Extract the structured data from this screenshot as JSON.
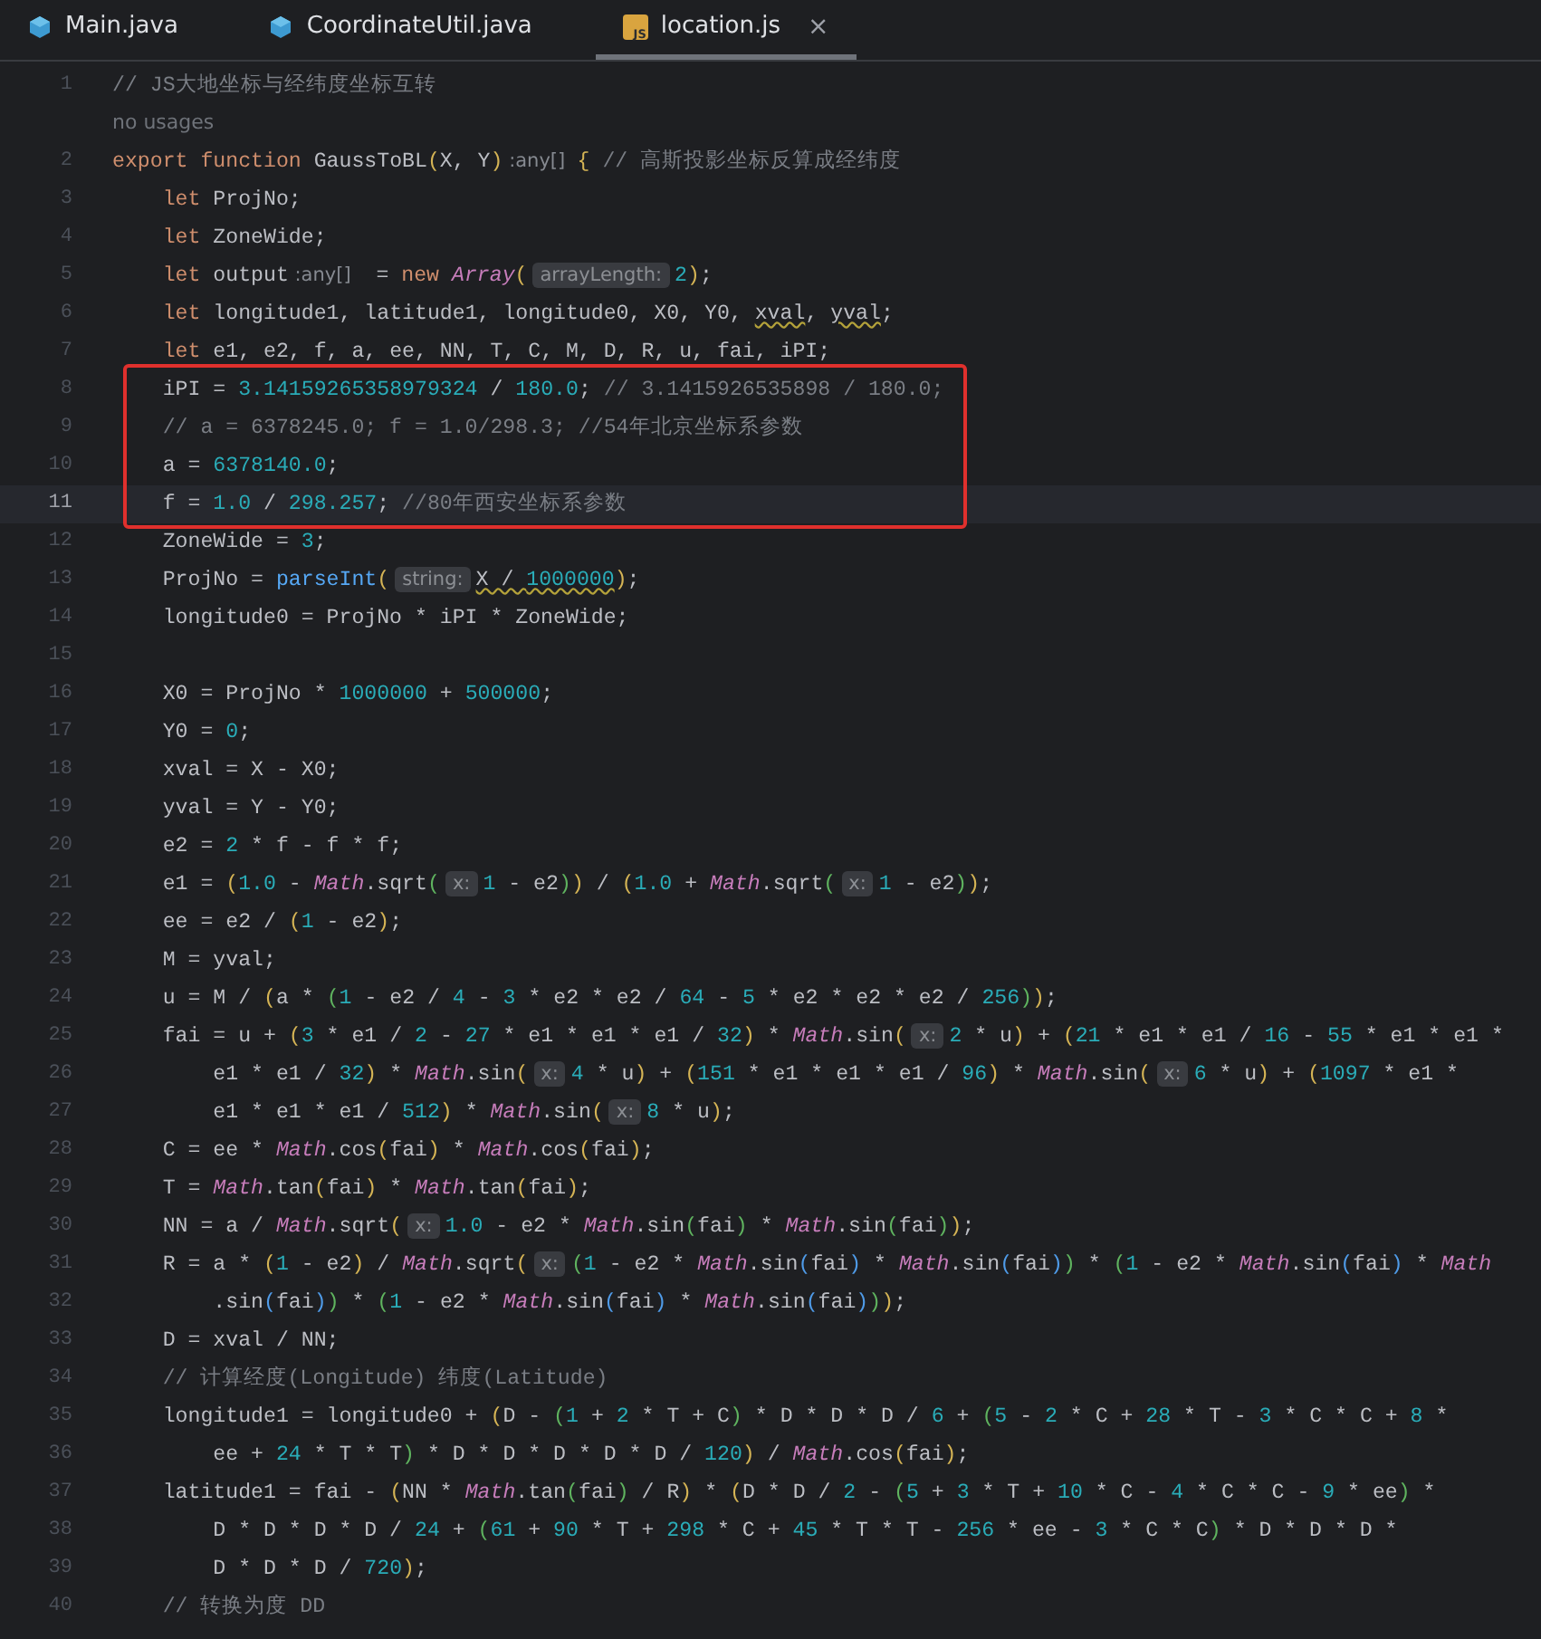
{
  "tabs": [
    {
      "label": "Main.java",
      "selected": false,
      "closable": false
    },
    {
      "label": "CoordinateUtil.java",
      "selected": false,
      "closable": false
    },
    {
      "label": "location.js",
      "icon_text": "JS",
      "selected": true,
      "closable": true,
      "close": "×"
    }
  ],
  "code": [
    {
      "kind": "line",
      "number": "1",
      "current": false,
      "segments": [
        {
          "kind": "cmt",
          "text": "// JS大地坐标与经纬度坐标互转"
        }
      ]
    },
    {
      "kind": "usages",
      "text": "no usages"
    },
    {
      "kind": "line",
      "number": "2",
      "current": false,
      "segments": [
        {
          "kind": "kw",
          "text": "export function "
        },
        {
          "kind": "t",
          "text": "GaussToBL"
        },
        {
          "kind": "p1",
          "text": "("
        },
        {
          "kind": "t",
          "text": "X, Y"
        },
        {
          "kind": "p1",
          "text": ")"
        },
        {
          "kind": "type",
          "text": " :any[]  "
        },
        {
          "kind": "p1",
          "text": "{"
        },
        {
          "kind": "cmt",
          "text": " // 高斯投影坐标反算成经纬度"
        }
      ]
    },
    {
      "kind": "line",
      "number": "3",
      "current": false,
      "segments": [
        {
          "kind": "kw",
          "text": "    let "
        },
        {
          "kind": "t",
          "text": "ProjNo;"
        }
      ]
    },
    {
      "kind": "line",
      "number": "4",
      "current": false,
      "segments": [
        {
          "kind": "kw",
          "text": "    let "
        },
        {
          "kind": "t",
          "text": "ZoneWide;"
        }
      ]
    },
    {
      "kind": "line",
      "number": "5",
      "current": false,
      "segments": [
        {
          "kind": "kw",
          "text": "    let "
        },
        {
          "kind": "t",
          "text": "output"
        },
        {
          "kind": "type",
          "text": " :any[]"
        },
        {
          "kind": "t",
          "text": "  = "
        },
        {
          "kind": "kw",
          "text": "new "
        },
        {
          "kind": "cls",
          "text": "Array"
        },
        {
          "kind": "p1",
          "text": "("
        },
        {
          "kind": "hint",
          "text": "arrayLength:"
        },
        {
          "kind": "num",
          "text": "2"
        },
        {
          "kind": "p1",
          "text": ")"
        },
        {
          "kind": "t",
          "text": ";"
        }
      ]
    },
    {
      "kind": "line",
      "number": "6",
      "current": false,
      "segments": [
        {
          "kind": "kw",
          "text": "    let "
        },
        {
          "kind": "t",
          "text": "longitude1, latitude1, longitude0, X0, Y0, "
        },
        {
          "kind": "warn",
          "text": "xval"
        },
        {
          "kind": "t",
          "text": ", "
        },
        {
          "kind": "warn",
          "text": "yval"
        },
        {
          "kind": "t",
          "text": ";"
        }
      ]
    },
    {
      "kind": "line",
      "number": "7",
      "current": false,
      "segments": [
        {
          "kind": "kw",
          "text": "    let "
        },
        {
          "kind": "t",
          "text": "e1, e2, f, a, ee, NN, T, C, M, D, R, u, fai, iPI;"
        }
      ]
    },
    {
      "kind": "boxed",
      "rows": [
        {
          "kind": "line",
          "number": "8",
          "current": false,
          "segments": [
            {
              "kind": "t",
              "text": "    iPI = "
            },
            {
              "kind": "num",
              "text": "3.14159265358979324"
            },
            {
              "kind": "t",
              "text": " / "
            },
            {
              "kind": "num",
              "text": "180.0"
            },
            {
              "kind": "t",
              "text": "; "
            },
            {
              "kind": "cmt",
              "text": "// 3.1415926535898 / 180.0;"
            }
          ]
        },
        {
          "kind": "line",
          "number": "9",
          "current": false,
          "segments": [
            {
              "kind": "cmt",
              "text": "    // a = 6378245.0; f = 1.0/298.3; //54年北京坐标系参数"
            }
          ]
        },
        {
          "kind": "line",
          "number": "10",
          "current": false,
          "segments": [
            {
              "kind": "t",
              "text": "    a = "
            },
            {
              "kind": "num",
              "text": "6378140.0"
            },
            {
              "kind": "t",
              "text": ";"
            }
          ]
        },
        {
          "kind": "line",
          "number": "11",
          "current": true,
          "segments": [
            {
              "kind": "t",
              "text": "    f = "
            },
            {
              "kind": "num",
              "text": "1.0"
            },
            {
              "kind": "t",
              "text": " / "
            },
            {
              "kind": "num",
              "text": "298.257"
            },
            {
              "kind": "t",
              "text": "; "
            },
            {
              "kind": "cmt",
              "text": "//80年西安坐标系参数"
            }
          ]
        }
      ]
    },
    {
      "kind": "line",
      "number": "12",
      "current": false,
      "segments": [
        {
          "kind": "t",
          "text": "    ZoneWide = "
        },
        {
          "kind": "num",
          "text": "3"
        },
        {
          "kind": "t",
          "text": ";"
        }
      ]
    },
    {
      "kind": "line",
      "number": "13",
      "current": false,
      "segments": [
        {
          "kind": "t",
          "text": "    ProjNo = "
        },
        {
          "kind": "fn",
          "text": "parseInt"
        },
        {
          "kind": "p1",
          "text": "("
        },
        {
          "kind": "hint",
          "text": "string:"
        },
        {
          "kind": "warn",
          "text": "X / "
        },
        {
          "kind": "warn_num",
          "text": "1000000"
        },
        {
          "kind": "p1",
          "text": ")"
        },
        {
          "kind": "t",
          "text": ";"
        }
      ]
    },
    {
      "kind": "line",
      "number": "14",
      "current": false,
      "segments": [
        {
          "kind": "t",
          "text": "    longitude0 = ProjNo * iPI * ZoneWide;"
        }
      ]
    },
    {
      "kind": "line",
      "number": "15",
      "current": false
    },
    {
      "kind": "line",
      "number": "16",
      "current": false,
      "segments": [
        {
          "kind": "t",
          "text": "    X0 = ProjNo * "
        },
        {
          "kind": "num",
          "text": "1000000"
        },
        {
          "kind": "t",
          "text": " + "
        },
        {
          "kind": "num",
          "text": "500000"
        },
        {
          "kind": "t",
          "text": ";"
        }
      ]
    },
    {
      "kind": "line",
      "number": "17",
      "current": false,
      "segments": [
        {
          "kind": "t",
          "text": "    Y0 = "
        },
        {
          "kind": "num",
          "text": "0"
        },
        {
          "kind": "t",
          "text": ";"
        }
      ]
    },
    {
      "kind": "line",
      "number": "18",
      "current": false,
      "segments": [
        {
          "kind": "t",
          "text": "    xval = X - X0;"
        }
      ]
    },
    {
      "kind": "line",
      "number": "19",
      "current": false,
      "segments": [
        {
          "kind": "t",
          "text": "    yval = Y - Y0;"
        }
      ]
    },
    {
      "kind": "line",
      "number": "20",
      "current": false,
      "segments": [
        {
          "kind": "t",
          "text": "    e2 = "
        },
        {
          "kind": "num",
          "text": "2"
        },
        {
          "kind": "t",
          "text": " * f - f * f;"
        }
      ]
    },
    {
      "kind": "line",
      "number": "21",
      "current": false,
      "segments": [
        {
          "kind": "t",
          "text": "    e1 = "
        },
        {
          "kind": "p1",
          "text": "("
        },
        {
          "kind": "num",
          "text": "1.0"
        },
        {
          "kind": "t",
          "text": " - "
        },
        {
          "kind": "cls",
          "text": "Math"
        },
        {
          "kind": "t",
          "text": ".sqrt"
        },
        {
          "kind": "p2",
          "text": "("
        },
        {
          "kind": "hint",
          "text": "x:"
        },
        {
          "kind": "num",
          "text": "1"
        },
        {
          "kind": "t",
          "text": " - e2"
        },
        {
          "kind": "p2",
          "text": ")"
        },
        {
          "kind": "p1",
          "text": ")"
        },
        {
          "kind": "t",
          "text": " / "
        },
        {
          "kind": "p1",
          "text": "("
        },
        {
          "kind": "num",
          "text": "1.0"
        },
        {
          "kind": "t",
          "text": " + "
        },
        {
          "kind": "cls",
          "text": "Math"
        },
        {
          "kind": "t",
          "text": ".sqrt"
        },
        {
          "kind": "p2",
          "text": "("
        },
        {
          "kind": "hint",
          "text": "x:"
        },
        {
          "kind": "num",
          "text": "1"
        },
        {
          "kind": "t",
          "text": " - e2"
        },
        {
          "kind": "p2",
          "text": ")"
        },
        {
          "kind": "p1",
          "text": ")"
        },
        {
          "kind": "t",
          "text": ";"
        }
      ]
    },
    {
      "kind": "line",
      "number": "22",
      "current": false,
      "segments": [
        {
          "kind": "t",
          "text": "    ee = e2 / "
        },
        {
          "kind": "p1",
          "text": "("
        },
        {
          "kind": "num",
          "text": "1"
        },
        {
          "kind": "t",
          "text": " - e2"
        },
        {
          "kind": "p1",
          "text": ")"
        },
        {
          "kind": "t",
          "text": ";"
        }
      ]
    },
    {
      "kind": "line",
      "number": "23",
      "current": false,
      "segments": [
        {
          "kind": "t",
          "text": "    M = yval;"
        }
      ]
    },
    {
      "kind": "line",
      "number": "24",
      "current": false,
      "segments": [
        {
          "kind": "t",
          "text": "    u = M / "
        },
        {
          "kind": "p1",
          "text": "("
        },
        {
          "kind": "t",
          "text": "a * "
        },
        {
          "kind": "p2",
          "text": "("
        },
        {
          "kind": "num",
          "text": "1"
        },
        {
          "kind": "t",
          "text": " - e2 / "
        },
        {
          "kind": "num",
          "text": "4"
        },
        {
          "kind": "t",
          "text": " - "
        },
        {
          "kind": "num",
          "text": "3"
        },
        {
          "kind": "t",
          "text": " * e2 * e2 / "
        },
        {
          "kind": "num",
          "text": "64"
        },
        {
          "kind": "t",
          "text": " - "
        },
        {
          "kind": "num",
          "text": "5"
        },
        {
          "kind": "t",
          "text": " * e2 * e2 * e2 / "
        },
        {
          "kind": "num",
          "text": "256"
        },
        {
          "kind": "p2",
          "text": ")"
        },
        {
          "kind": "p1",
          "text": ")"
        },
        {
          "kind": "t",
          "text": ";"
        }
      ]
    },
    {
      "kind": "line",
      "number": "25",
      "current": false,
      "segments": [
        {
          "kind": "t",
          "text": "    fai = u + "
        },
        {
          "kind": "p1",
          "text": "("
        },
        {
          "kind": "num",
          "text": "3"
        },
        {
          "kind": "t",
          "text": " * e1 / "
        },
        {
          "kind": "num",
          "text": "2"
        },
        {
          "kind": "t",
          "text": " - "
        },
        {
          "kind": "num",
          "text": "27"
        },
        {
          "kind": "t",
          "text": " * e1 * e1 * e1 / "
        },
        {
          "kind": "num",
          "text": "32"
        },
        {
          "kind": "p1",
          "text": ")"
        },
        {
          "kind": "t",
          "text": " * "
        },
        {
          "kind": "cls",
          "text": "Math"
        },
        {
          "kind": "t",
          "text": ".sin"
        },
        {
          "kind": "p1",
          "text": "("
        },
        {
          "kind": "hint",
          "text": "x:"
        },
        {
          "kind": "num",
          "text": "2"
        },
        {
          "kind": "t",
          "text": " * u"
        },
        {
          "kind": "p1",
          "text": ")"
        },
        {
          "kind": "t",
          "text": " + "
        },
        {
          "kind": "p1",
          "text": "("
        },
        {
          "kind": "num",
          "text": "21"
        },
        {
          "kind": "t",
          "text": " * e1 * e1 / "
        },
        {
          "kind": "num",
          "text": "16"
        },
        {
          "kind": "t",
          "text": " - "
        },
        {
          "kind": "num",
          "text": "55"
        },
        {
          "kind": "t",
          "text": " * e1 * e1 *"
        }
      ]
    },
    {
      "kind": "line",
      "number": "26",
      "current": false,
      "segments": [
        {
          "kind": "t",
          "text": "        e1 * e1 / "
        },
        {
          "kind": "num",
          "text": "32"
        },
        {
          "kind": "p1",
          "text": ")"
        },
        {
          "kind": "t",
          "text": " * "
        },
        {
          "kind": "cls",
          "text": "Math"
        },
        {
          "kind": "t",
          "text": ".sin"
        },
        {
          "kind": "p1",
          "text": "("
        },
        {
          "kind": "hint",
          "text": "x:"
        },
        {
          "kind": "num",
          "text": "4"
        },
        {
          "kind": "t",
          "text": " * u"
        },
        {
          "kind": "p1",
          "text": ")"
        },
        {
          "kind": "t",
          "text": " + "
        },
        {
          "kind": "p1",
          "text": "("
        },
        {
          "kind": "num",
          "text": "151"
        },
        {
          "kind": "t",
          "text": " * e1 * e1 * e1 / "
        },
        {
          "kind": "num",
          "text": "96"
        },
        {
          "kind": "p1",
          "text": ")"
        },
        {
          "kind": "t",
          "text": " * "
        },
        {
          "kind": "cls",
          "text": "Math"
        },
        {
          "kind": "t",
          "text": ".sin"
        },
        {
          "kind": "p1",
          "text": "("
        },
        {
          "kind": "hint",
          "text": "x:"
        },
        {
          "kind": "num",
          "text": "6"
        },
        {
          "kind": "t",
          "text": " * u"
        },
        {
          "kind": "p1",
          "text": ")"
        },
        {
          "kind": "t",
          "text": " + "
        },
        {
          "kind": "p1",
          "text": "("
        },
        {
          "kind": "num",
          "text": "1097"
        },
        {
          "kind": "t",
          "text": " * e1 *"
        }
      ]
    },
    {
      "kind": "line",
      "number": "27",
      "current": false,
      "segments": [
        {
          "kind": "t",
          "text": "        e1 * e1 * e1 / "
        },
        {
          "kind": "num",
          "text": "512"
        },
        {
          "kind": "p1",
          "text": ")"
        },
        {
          "kind": "t",
          "text": " * "
        },
        {
          "kind": "cls",
          "text": "Math"
        },
        {
          "kind": "t",
          "text": ".sin"
        },
        {
          "kind": "p1",
          "text": "("
        },
        {
          "kind": "hint",
          "text": "x:"
        },
        {
          "kind": "num",
          "text": "8"
        },
        {
          "kind": "t",
          "text": " * u"
        },
        {
          "kind": "p1",
          "text": ")"
        },
        {
          "kind": "t",
          "text": ";"
        }
      ]
    },
    {
      "kind": "line",
      "number": "28",
      "current": false,
      "segments": [
        {
          "kind": "t",
          "text": "    C = ee * "
        },
        {
          "kind": "cls",
          "text": "Math"
        },
        {
          "kind": "t",
          "text": ".cos"
        },
        {
          "kind": "p1",
          "text": "("
        },
        {
          "kind": "t",
          "text": "fai"
        },
        {
          "kind": "p1",
          "text": ")"
        },
        {
          "kind": "t",
          "text": " * "
        },
        {
          "kind": "cls",
          "text": "Math"
        },
        {
          "kind": "t",
          "text": ".cos"
        },
        {
          "kind": "p1",
          "text": "("
        },
        {
          "kind": "t",
          "text": "fai"
        },
        {
          "kind": "p1",
          "text": ")"
        },
        {
          "kind": "t",
          "text": ";"
        }
      ]
    },
    {
      "kind": "line",
      "number": "29",
      "current": false,
      "segments": [
        {
          "kind": "t",
          "text": "    T = "
        },
        {
          "kind": "cls",
          "text": "Math"
        },
        {
          "kind": "t",
          "text": ".tan"
        },
        {
          "kind": "p1",
          "text": "("
        },
        {
          "kind": "t",
          "text": "fai"
        },
        {
          "kind": "p1",
          "text": ")"
        },
        {
          "kind": "t",
          "text": " * "
        },
        {
          "kind": "cls",
          "text": "Math"
        },
        {
          "kind": "t",
          "text": ".tan"
        },
        {
          "kind": "p1",
          "text": "("
        },
        {
          "kind": "t",
          "text": "fai"
        },
        {
          "kind": "p1",
          "text": ")"
        },
        {
          "kind": "t",
          "text": ";"
        }
      ]
    },
    {
      "kind": "line",
      "number": "30",
      "current": false,
      "segments": [
        {
          "kind": "t",
          "text": "    NN = a / "
        },
        {
          "kind": "cls",
          "text": "Math"
        },
        {
          "kind": "t",
          "text": ".sqrt"
        },
        {
          "kind": "p1",
          "text": "("
        },
        {
          "kind": "hint",
          "text": "x:"
        },
        {
          "kind": "num",
          "text": "1.0"
        },
        {
          "kind": "t",
          "text": " - e2 * "
        },
        {
          "kind": "cls",
          "text": "Math"
        },
        {
          "kind": "t",
          "text": ".sin"
        },
        {
          "kind": "p2",
          "text": "("
        },
        {
          "kind": "t",
          "text": "fai"
        },
        {
          "kind": "p2",
          "text": ")"
        },
        {
          "kind": "t",
          "text": " * "
        },
        {
          "kind": "cls",
          "text": "Math"
        },
        {
          "kind": "t",
          "text": ".sin"
        },
        {
          "kind": "p2",
          "text": "("
        },
        {
          "kind": "t",
          "text": "fai"
        },
        {
          "kind": "p2",
          "text": ")"
        },
        {
          "kind": "p1",
          "text": ")"
        },
        {
          "kind": "t",
          "text": ";"
        }
      ]
    },
    {
      "kind": "line",
      "number": "31",
      "current": false,
      "segments": [
        {
          "kind": "t",
          "text": "    R = a * "
        },
        {
          "kind": "p1",
          "text": "("
        },
        {
          "kind": "num",
          "text": "1"
        },
        {
          "kind": "t",
          "text": " - e2"
        },
        {
          "kind": "p1",
          "text": ")"
        },
        {
          "kind": "t",
          "text": " / "
        },
        {
          "kind": "cls",
          "text": "Math"
        },
        {
          "kind": "t",
          "text": ".sqrt"
        },
        {
          "kind": "p1",
          "text": "("
        },
        {
          "kind": "hint",
          "text": "x:"
        },
        {
          "kind": "p2",
          "text": "("
        },
        {
          "kind": "num",
          "text": "1"
        },
        {
          "kind": "t",
          "text": " - e2 * "
        },
        {
          "kind": "cls",
          "text": "Math"
        },
        {
          "kind": "t",
          "text": ".sin"
        },
        {
          "kind": "p3",
          "text": "("
        },
        {
          "kind": "t",
          "text": "fai"
        },
        {
          "kind": "p3",
          "text": ")"
        },
        {
          "kind": "t",
          "text": " * "
        },
        {
          "kind": "cls",
          "text": "Math"
        },
        {
          "kind": "t",
          "text": ".sin"
        },
        {
          "kind": "p3",
          "text": "("
        },
        {
          "kind": "t",
          "text": "fai"
        },
        {
          "kind": "p3",
          "text": ")"
        },
        {
          "kind": "p2",
          "text": ")"
        },
        {
          "kind": "t",
          "text": " * "
        },
        {
          "kind": "p2",
          "text": "("
        },
        {
          "kind": "num",
          "text": "1"
        },
        {
          "kind": "t",
          "text": " - e2 * "
        },
        {
          "kind": "cls",
          "text": "Math"
        },
        {
          "kind": "t",
          "text": ".sin"
        },
        {
          "kind": "p3",
          "text": "("
        },
        {
          "kind": "t",
          "text": "fai"
        },
        {
          "kind": "p3",
          "text": ")"
        },
        {
          "kind": "t",
          "text": " * "
        },
        {
          "kind": "cls",
          "text": "Math"
        }
      ]
    },
    {
      "kind": "line",
      "number": "32",
      "current": false,
      "segments": [
        {
          "kind": "t",
          "text": "        .sin"
        },
        {
          "kind": "p3",
          "text": "("
        },
        {
          "kind": "t",
          "text": "fai"
        },
        {
          "kind": "p3",
          "text": ")"
        },
        {
          "kind": "p2",
          "text": ")"
        },
        {
          "kind": "t",
          "text": " * "
        },
        {
          "kind": "p2",
          "text": "("
        },
        {
          "kind": "num",
          "text": "1"
        },
        {
          "kind": "t",
          "text": " - e2 * "
        },
        {
          "kind": "cls",
          "text": "Math"
        },
        {
          "kind": "t",
          "text": ".sin"
        },
        {
          "kind": "p3",
          "text": "("
        },
        {
          "kind": "t",
          "text": "fai"
        },
        {
          "kind": "p3",
          "text": ")"
        },
        {
          "kind": "t",
          "text": " * "
        },
        {
          "kind": "cls",
          "text": "Math"
        },
        {
          "kind": "t",
          "text": ".sin"
        },
        {
          "kind": "p3",
          "text": "("
        },
        {
          "kind": "t",
          "text": "fai"
        },
        {
          "kind": "p3",
          "text": ")"
        },
        {
          "kind": "p2",
          "text": ")"
        },
        {
          "kind": "p1",
          "text": ")"
        },
        {
          "kind": "t",
          "text": ";"
        }
      ]
    },
    {
      "kind": "line",
      "number": "33",
      "current": false,
      "segments": [
        {
          "kind": "t",
          "text": "    D = xval / NN;"
        }
      ]
    },
    {
      "kind": "line",
      "number": "34",
      "current": false,
      "segments": [
        {
          "kind": "cmt",
          "text": "    // 计算经度(Longitude) 纬度(Latitude)"
        }
      ]
    },
    {
      "kind": "line",
      "number": "35",
      "current": false,
      "segments": [
        {
          "kind": "t",
          "text": "    longitude1 = longitude0 + "
        },
        {
          "kind": "p1",
          "text": "("
        },
        {
          "kind": "t",
          "text": "D - "
        },
        {
          "kind": "p2",
          "text": "("
        },
        {
          "kind": "num",
          "text": "1"
        },
        {
          "kind": "t",
          "text": " + "
        },
        {
          "kind": "num",
          "text": "2"
        },
        {
          "kind": "t",
          "text": " * T + C"
        },
        {
          "kind": "p2",
          "text": ")"
        },
        {
          "kind": "t",
          "text": " * D * D * D / "
        },
        {
          "kind": "num",
          "text": "6"
        },
        {
          "kind": "t",
          "text": " + "
        },
        {
          "kind": "p2",
          "text": "("
        },
        {
          "kind": "num",
          "text": "5"
        },
        {
          "kind": "t",
          "text": " - "
        },
        {
          "kind": "num",
          "text": "2"
        },
        {
          "kind": "t",
          "text": " * C + "
        },
        {
          "kind": "num",
          "text": "28"
        },
        {
          "kind": "t",
          "text": " * T - "
        },
        {
          "kind": "num",
          "text": "3"
        },
        {
          "kind": "t",
          "text": " * C * C + "
        },
        {
          "kind": "num",
          "text": "8"
        },
        {
          "kind": "t",
          "text": " *"
        }
      ]
    },
    {
      "kind": "line",
      "number": "36",
      "current": false,
      "segments": [
        {
          "kind": "t",
          "text": "        ee + "
        },
        {
          "kind": "num",
          "text": "24"
        },
        {
          "kind": "t",
          "text": " * T * T"
        },
        {
          "kind": "p2",
          "text": ")"
        },
        {
          "kind": "t",
          "text": " * D * D * D * D * D / "
        },
        {
          "kind": "num",
          "text": "120"
        },
        {
          "kind": "p1",
          "text": ")"
        },
        {
          "kind": "t",
          "text": " / "
        },
        {
          "kind": "cls",
          "text": "Math"
        },
        {
          "kind": "t",
          "text": ".cos"
        },
        {
          "kind": "p1",
          "text": "("
        },
        {
          "kind": "t",
          "text": "fai"
        },
        {
          "kind": "p1",
          "text": ")"
        },
        {
          "kind": "t",
          "text": ";"
        }
      ]
    },
    {
      "kind": "line",
      "number": "37",
      "current": false,
      "segments": [
        {
          "kind": "t",
          "text": "    latitude1 = fai - "
        },
        {
          "kind": "p1",
          "text": "("
        },
        {
          "kind": "t",
          "text": "NN * "
        },
        {
          "kind": "cls",
          "text": "Math"
        },
        {
          "kind": "t",
          "text": ".tan"
        },
        {
          "kind": "p2",
          "text": "("
        },
        {
          "kind": "t",
          "text": "fai"
        },
        {
          "kind": "p2",
          "text": ")"
        },
        {
          "kind": "t",
          "text": " / R"
        },
        {
          "kind": "p1",
          "text": ")"
        },
        {
          "kind": "t",
          "text": " * "
        },
        {
          "kind": "p1",
          "text": "("
        },
        {
          "kind": "t",
          "text": "D * D / "
        },
        {
          "kind": "num",
          "text": "2"
        },
        {
          "kind": "t",
          "text": " - "
        },
        {
          "kind": "p2",
          "text": "("
        },
        {
          "kind": "num",
          "text": "5"
        },
        {
          "kind": "t",
          "text": " + "
        },
        {
          "kind": "num",
          "text": "3"
        },
        {
          "kind": "t",
          "text": " * T + "
        },
        {
          "kind": "num",
          "text": "10"
        },
        {
          "kind": "t",
          "text": " * C - "
        },
        {
          "kind": "num",
          "text": "4"
        },
        {
          "kind": "t",
          "text": " * C * C - "
        },
        {
          "kind": "num",
          "text": "9"
        },
        {
          "kind": "t",
          "text": " * ee"
        },
        {
          "kind": "p2",
          "text": ")"
        },
        {
          "kind": "t",
          "text": " *"
        }
      ]
    },
    {
      "kind": "line",
      "number": "38",
      "current": false,
      "segments": [
        {
          "kind": "t",
          "text": "        D * D * D * D / "
        },
        {
          "kind": "num",
          "text": "24"
        },
        {
          "kind": "t",
          "text": " + "
        },
        {
          "kind": "p2",
          "text": "("
        },
        {
          "kind": "num",
          "text": "61"
        },
        {
          "kind": "t",
          "text": " + "
        },
        {
          "kind": "num",
          "text": "90"
        },
        {
          "kind": "t",
          "text": " * T + "
        },
        {
          "kind": "num",
          "text": "298"
        },
        {
          "kind": "t",
          "text": " * C + "
        },
        {
          "kind": "num",
          "text": "45"
        },
        {
          "kind": "t",
          "text": " * T * T - "
        },
        {
          "kind": "num",
          "text": "256"
        },
        {
          "kind": "t",
          "text": " * ee - "
        },
        {
          "kind": "num",
          "text": "3"
        },
        {
          "kind": "t",
          "text": " * C * C"
        },
        {
          "kind": "p2",
          "text": ")"
        },
        {
          "kind": "t",
          "text": " * D * D * D *"
        }
      ]
    },
    {
      "kind": "line",
      "number": "39",
      "current": false,
      "segments": [
        {
          "kind": "t",
          "text": "        D * D * D / "
        },
        {
          "kind": "num",
          "text": "720"
        },
        {
          "kind": "p1",
          "text": ")"
        },
        {
          "kind": "t",
          "text": ";"
        }
      ]
    },
    {
      "kind": "line",
      "number": "40",
      "current": false,
      "segments": [
        {
          "kind": "cmt",
          "text": "    // 转换为度 DD"
        }
      ]
    }
  ]
}
